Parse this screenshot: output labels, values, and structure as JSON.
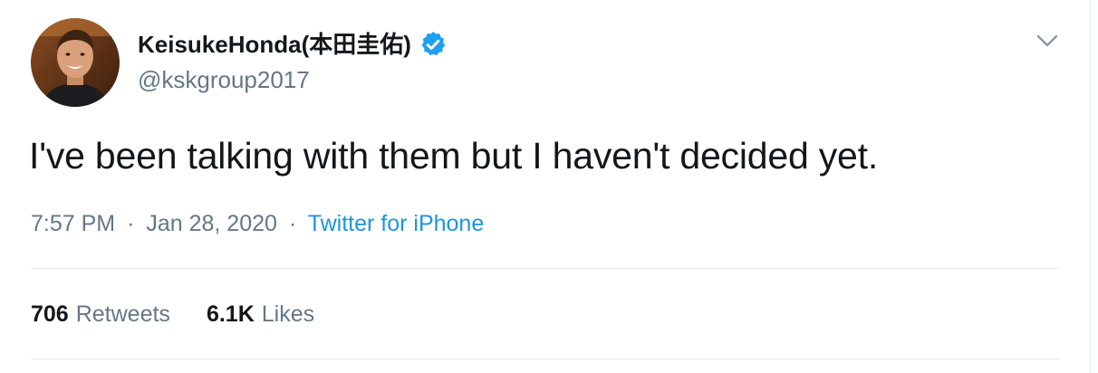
{
  "author": {
    "display_name": "KeisukeHonda(本田圭佑)",
    "handle": "@kskgroup2017",
    "verified_icon": "verified-badge-icon",
    "avatar_icon": "user-avatar"
  },
  "menu": {
    "icon": "chevron-down-icon"
  },
  "tweet": {
    "text": "I've been talking with them but I haven't decided yet."
  },
  "meta": {
    "time": "7:57 PM",
    "separator1": "·",
    "date": "Jan 28, 2020",
    "separator2": "·",
    "source": "Twitter for iPhone"
  },
  "stats": {
    "retweets_count": "706",
    "retweets_label": "Retweets",
    "likes_count": "6.1K",
    "likes_label": "Likes"
  },
  "colors": {
    "text_primary": "#14171a",
    "text_secondary": "#657786",
    "link": "#1b95e0",
    "verified": "#1da1f2",
    "divider": "#e6ecf0"
  }
}
